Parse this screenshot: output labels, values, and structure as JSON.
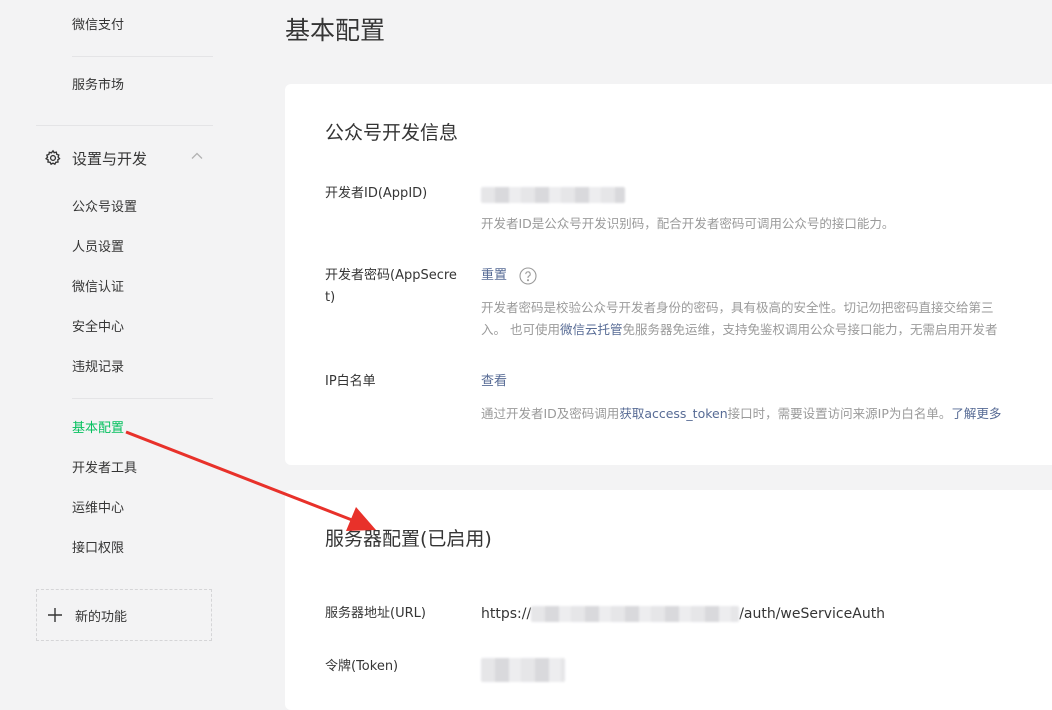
{
  "sidebar": {
    "top_items": [
      "微信支付",
      "服务市场"
    ],
    "group": {
      "label": "设置与开发",
      "icon": "gear-icon"
    },
    "items": [
      {
        "label": "公众号设置"
      },
      {
        "label": "人员设置"
      },
      {
        "label": "微信认证"
      },
      {
        "label": "安全中心"
      },
      {
        "label": "违规记录"
      },
      {
        "label": "基本配置",
        "active": true
      },
      {
        "label": "开发者工具"
      },
      {
        "label": "运维中心"
      },
      {
        "label": "接口权限"
      }
    ],
    "new_feature": "新的功能"
  },
  "page_title": "基本配置",
  "developer_info": {
    "title": "公众号开发信息",
    "appid": {
      "label": "开发者ID(AppID)",
      "desc": "开发者ID是公众号开发识别码，配合开发者密码可调用公众号的接口能力。"
    },
    "appsecret": {
      "label": "开发者密码(AppSecret)",
      "action": "重置",
      "desc_line1": "开发者密码是校验公众号开发者身份的密码，具有极高的安全性。切记勿把密码直接交给第三",
      "desc_line2_prefix": "入。 也可使用",
      "desc_line2_link": "微信云托管",
      "desc_line2_suffix": "免服务器免运维，支持免鉴权调用公众号接口能力，无需启用开发者"
    },
    "ip_whitelist": {
      "label": "IP白名单",
      "action": "查看",
      "desc_prefix": "通过开发者ID及密码调用",
      "desc_link": "获取access_token",
      "desc_suffix": "接口时，需要设置访问来源IP为白名单。",
      "learn_more": "了解更多"
    }
  },
  "server_config": {
    "title": "服务器配置(已启用)",
    "url": {
      "label": "服务器地址(URL)",
      "prefix": "https://",
      "suffix": "/auth/weServiceAuth"
    },
    "token": {
      "label": "令牌(Token)"
    }
  },
  "colors": {
    "accent": "#07c160",
    "link": "#576b95",
    "annotation_arrow": "#e8312a"
  }
}
